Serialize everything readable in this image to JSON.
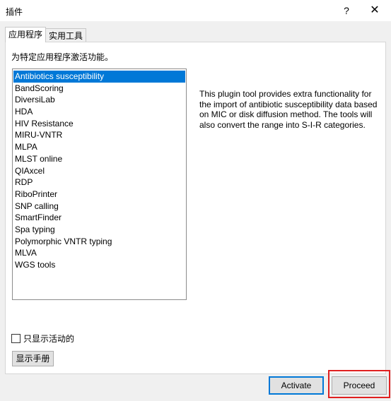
{
  "window": {
    "title": "插件",
    "help_glyph": "?",
    "close_glyph": "✕"
  },
  "tabs": [
    {
      "label": "应用程序",
      "active": true
    },
    {
      "label": "实用工具",
      "active": false
    }
  ],
  "panel": {
    "description": "为特定应用程序激活功能。",
    "plugins": [
      "Antibiotics susceptibility",
      "BandScoring",
      "DiversiLab",
      "HDA",
      "HIV Resistance",
      "MIRU-VNTR",
      "MLPA",
      "MLST online",
      "QIAxcel",
      "RDP",
      "RiboPrinter",
      "SNP calling",
      "SmartFinder",
      "Spa typing",
      "Polymorphic VNTR typing",
      "MLVA",
      "WGS tools"
    ],
    "selected_index": 0,
    "plugin_description": "This plugin tool provides extra functionality for the import of antibiotic susceptibility data based on MIC or disk diffusion method. The tools will also convert the range into S-I-R categories.",
    "show_active_only_label": "只显示活动的",
    "show_active_only_checked": false,
    "manual_button": "显示手册"
  },
  "footer": {
    "activate_button": "Activate",
    "proceed_button": "Proceed"
  },
  "colors": {
    "selection": "#0078d7",
    "highlight_box": "#e02020",
    "dialog_bg": "#f0f0f0"
  }
}
